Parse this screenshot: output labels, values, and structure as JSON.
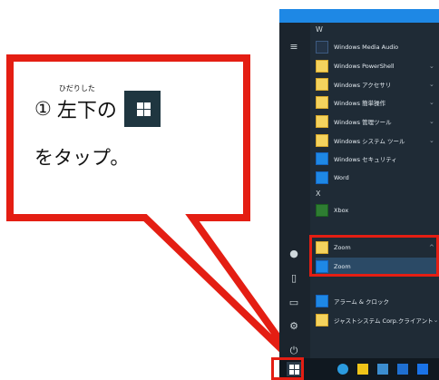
{
  "callout": {
    "step_number": "①",
    "ruby": "ひだりした",
    "word_left_bottom": "左下",
    "particle": "の",
    "second_line": "をタップ。"
  },
  "start_menu": {
    "section_w": "W",
    "items": [
      {
        "label": "Windows Media Audio",
        "icon": "media-icon"
      },
      {
        "label": "Windows PowerShell",
        "icon": "folder-icon",
        "chevron": "⌄"
      },
      {
        "label": "Windows アクセサリ",
        "icon": "folder-icon",
        "chevron": "⌄"
      },
      {
        "label": "Windows 簡単操作",
        "icon": "folder-icon",
        "chevron": "⌄"
      },
      {
        "label": "Windows 管理ツール",
        "icon": "folder-icon",
        "chevron": "⌄"
      },
      {
        "label": "Windows システム ツール",
        "icon": "folder-icon",
        "chevron": "⌄"
      },
      {
        "label": "Windows セキュリティ",
        "icon": "shield-icon"
      },
      {
        "label": "Word",
        "icon": "word-icon"
      }
    ],
    "section_x": "X",
    "xbox": {
      "label": "Xbox",
      "icon": "xbox-icon"
    },
    "zoom_folder": {
      "label": "Zoom",
      "chevron": "^"
    },
    "zoom_app": {
      "label": "Zoom"
    },
    "lower_items": [
      {
        "label": "アラーム & クロック",
        "icon": "clock-icon"
      },
      {
        "label": "ジャストシステム Corp.クライアント",
        "icon": "folder-icon",
        "chevron": "⌄"
      }
    ]
  },
  "colors": {
    "highlight": "#e41e13",
    "menu_bg": "#1f2b36",
    "accent": "#1e88e5"
  }
}
